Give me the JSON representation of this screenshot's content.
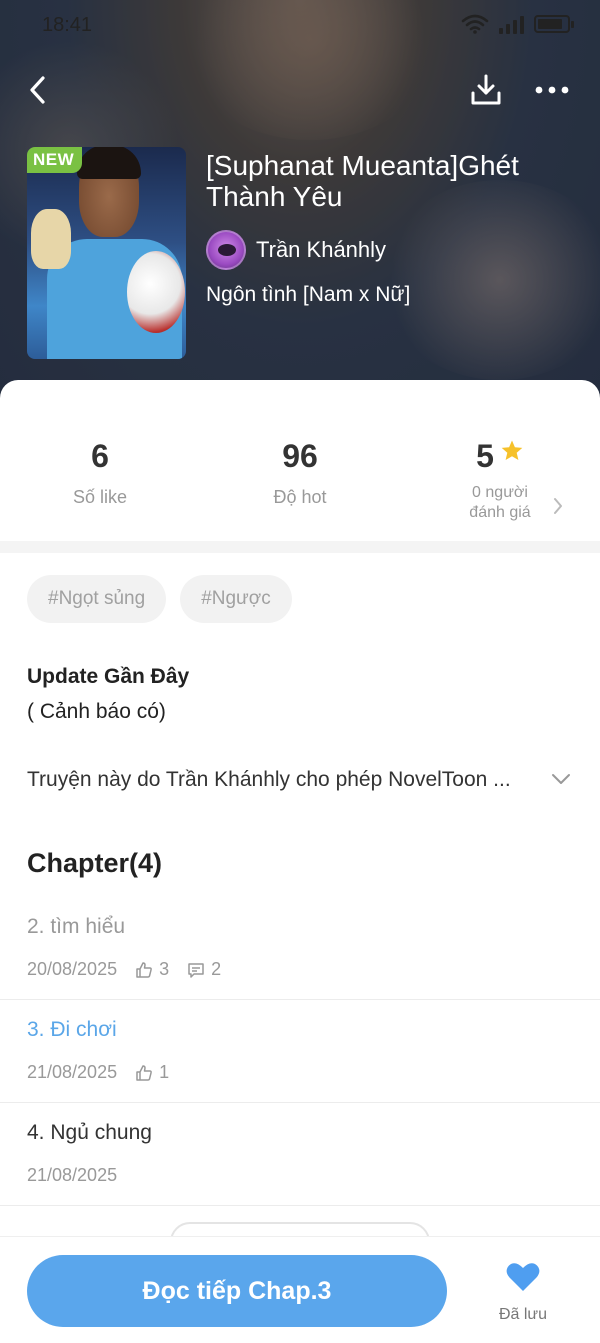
{
  "status": {
    "time": "18:41"
  },
  "book": {
    "badge": "NEW",
    "title": "[Suphanat Mueanta]Ghét Thành Yêu",
    "author": "Trần Khánhly",
    "genre": "Ngôn tình [Nam x Nữ]"
  },
  "stats": {
    "likes": {
      "value": "6",
      "label": "Số like"
    },
    "hot": {
      "value": "96",
      "label": "Độ hot"
    },
    "rating": {
      "value": "5",
      "label_line1": "0 người",
      "label_line2": "đánh giá"
    }
  },
  "tags": [
    "#Ngọt sủng",
    "#Ngược"
  ],
  "update": {
    "title": "Update Gần Đây",
    "subtitle": "( Cảnh báo có)"
  },
  "description": "Truyện này do Trần Khánhly cho phép NovelToon ...",
  "chapters": {
    "header": "Chapter(4)",
    "items": [
      {
        "title": "2. tìm hiểu",
        "date": "20/08/2025",
        "likes": "3",
        "comments": "2"
      },
      {
        "title": "3. Đi chơi",
        "date": "21/08/2025",
        "likes": "1"
      },
      {
        "title": "4. Ngủ chung",
        "date": "21/08/2025"
      }
    ]
  },
  "bottom": {
    "read_label": "Đọc tiếp Chap.3",
    "saved_label": "Đã lưu"
  },
  "colors": {
    "accent": "#5aa6ec",
    "badge_green": "#7ac143",
    "star": "#f6c12a",
    "heart": "#4f9ef0"
  },
  "icons": [
    "back-arrow-icon",
    "download-icon",
    "more-icon",
    "star-icon",
    "chevron-right-icon",
    "chevron-down-icon",
    "thumbs-up-icon",
    "comment-icon",
    "heart-icon",
    "wifi-icon",
    "signal-icon",
    "battery-icon"
  ]
}
